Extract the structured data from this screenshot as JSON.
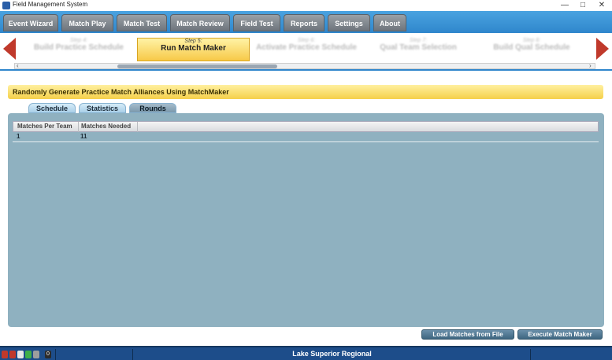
{
  "window": {
    "title": "Field Management System",
    "min_glyph": "—",
    "max_glyph": "□",
    "close_glyph": "✕"
  },
  "menu": {
    "items": [
      {
        "label": "Event Wizard"
      },
      {
        "label": "Match Play"
      },
      {
        "label": "Match Test"
      },
      {
        "label": "Match Review"
      },
      {
        "label": "Field Test"
      },
      {
        "label": "Reports"
      },
      {
        "label": "Settings"
      },
      {
        "label": "About"
      }
    ]
  },
  "wizard": {
    "steps": [
      {
        "num": "Step 4:",
        "name": "Build Practice Schedule"
      },
      {
        "num": "Step 5:",
        "name": "Run Match Maker",
        "active": true
      },
      {
        "num": "Step 6:",
        "name": "Activate Practice Schedule"
      },
      {
        "num": "Step 7:",
        "name": "Qual Team Selection"
      },
      {
        "num": "Step 8:",
        "name": "Build Qual Schedule"
      }
    ],
    "scroll_left_glyph": "‹",
    "scroll_right_glyph": "›",
    "prev_arrow_icon": "left-arrow-icon",
    "next_arrow_icon": "right-arrow-icon"
  },
  "content": {
    "banner": "Randomly Generate Practice Match Alliances Using MatchMaker",
    "tabs": [
      {
        "label": "Schedule"
      },
      {
        "label": "Statistics"
      },
      {
        "label": "Rounds",
        "active": true
      }
    ],
    "grid": {
      "columns": [
        "Matches Per Team",
        "Matches Needed"
      ],
      "rows": [
        [
          "1",
          "11"
        ]
      ]
    },
    "buttons": {
      "load": "Load Matches from File",
      "execute": "Execute Match Maker"
    }
  },
  "status": {
    "event": "Lake Superior Regional",
    "count": "0",
    "lights": [
      "#c0392b",
      "#c0392b",
      "#e6e6e6",
      "#3fae49",
      "#9e9e9e"
    ]
  },
  "colors": {
    "menu_bg": "#2f86cc",
    "accent": "#f5d04a",
    "panel": "#8fb1c0",
    "status_bg": "#1d4d8a"
  }
}
